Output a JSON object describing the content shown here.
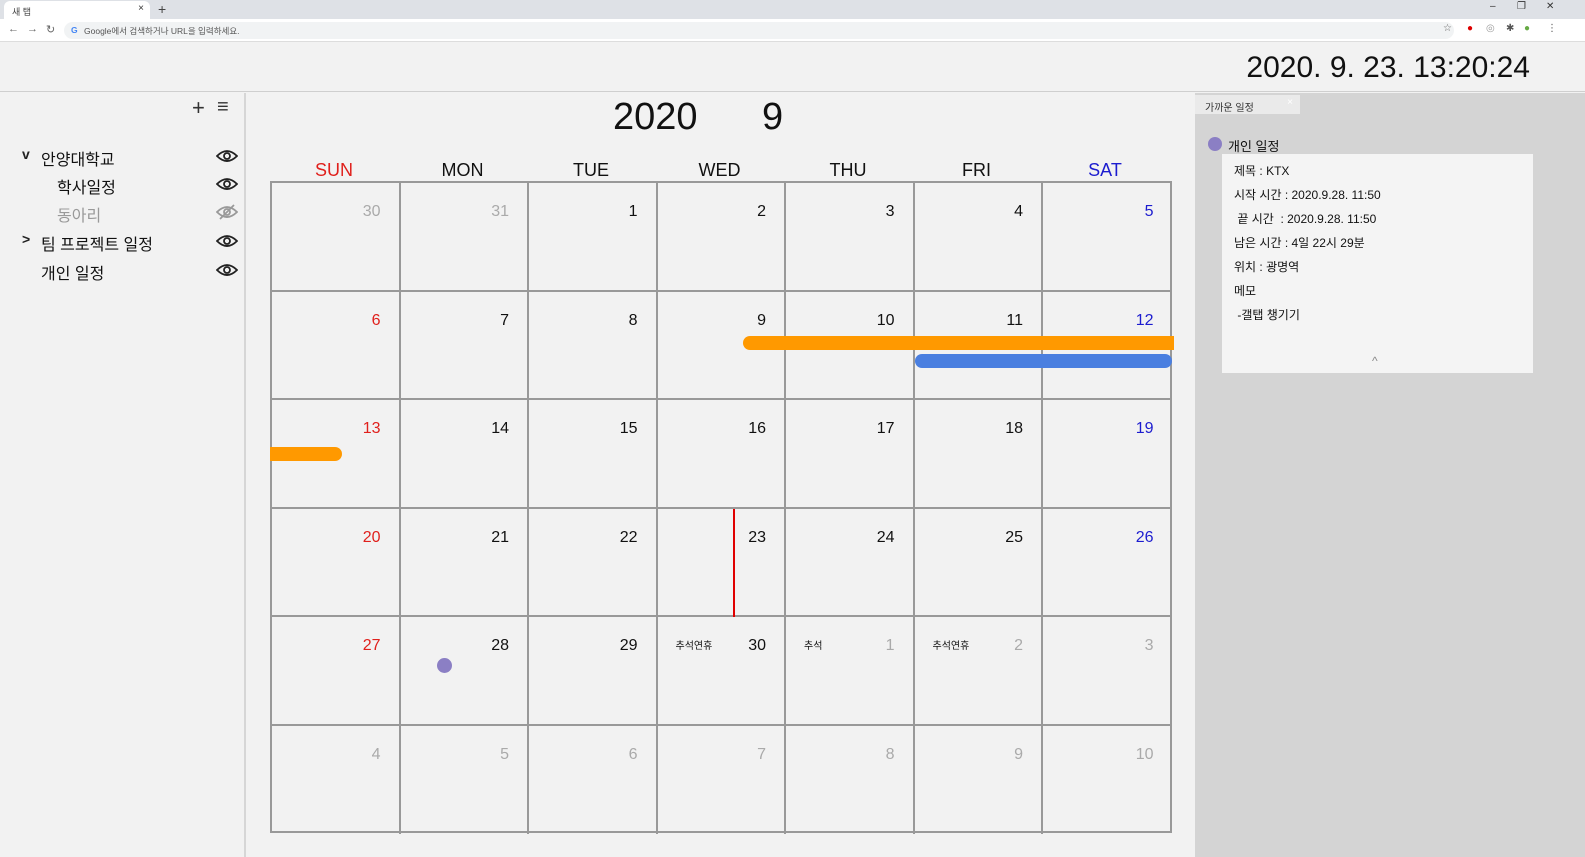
{
  "browser": {
    "tab_title": "새 탭",
    "tab_close": "×",
    "new_tab": "+",
    "omnibox_placeholder": "Google에서 검색하거나 URL을 입력하세요.",
    "win_min": "–",
    "win_restore": "❐",
    "win_close": "✕"
  },
  "header": {
    "clock": "2020. 9. 23. 13:20:24"
  },
  "sidebar": {
    "add_label": "+",
    "menu_label": "≡",
    "calendars": [
      {
        "label": "안양대학교",
        "chevron": "v",
        "level": 0,
        "visible": true
      },
      {
        "label": "학사일정",
        "chevron": "",
        "level": 1,
        "visible": true
      },
      {
        "label": "동아리",
        "chevron": "",
        "level": 1,
        "visible": false
      },
      {
        "label": "팀 프로젝트 일정",
        "chevron": ">",
        "level": 0,
        "visible": true
      },
      {
        "label": "개인 일정",
        "chevron": "",
        "level": 0,
        "visible": true
      }
    ]
  },
  "calendar": {
    "year": "2020",
    "month": "9",
    "weekdays": [
      "SUN",
      "MON",
      "TUE",
      "WED",
      "THU",
      "FRI",
      "SAT"
    ],
    "weeks": [
      [
        "30",
        "31",
        "1",
        "2",
        "3",
        "4",
        "5"
      ],
      [
        "6",
        "7",
        "8",
        "9",
        "10",
        "11",
        "12"
      ],
      [
        "13",
        "14",
        "15",
        "16",
        "17",
        "18",
        "19"
      ],
      [
        "20",
        "21",
        "22",
        "23",
        "24",
        "25",
        "26"
      ],
      [
        "27",
        "28",
        "29",
        "30",
        "1",
        "2",
        "3"
      ],
      [
        "4",
        "5",
        "6",
        "7",
        "8",
        "9",
        "10"
      ]
    ],
    "current_month_mask": [
      [
        false,
        false,
        true,
        true,
        true,
        true,
        true
      ],
      [
        true,
        true,
        true,
        true,
        true,
        true,
        true
      ],
      [
        true,
        true,
        true,
        true,
        true,
        true,
        true
      ],
      [
        true,
        true,
        true,
        true,
        true,
        true,
        true
      ],
      [
        true,
        true,
        true,
        true,
        false,
        false,
        false
      ],
      [
        false,
        false,
        false,
        false,
        false,
        false,
        false
      ]
    ],
    "holiday_labels": [
      {
        "week": 4,
        "day": 3,
        "text": "추석연휴"
      },
      {
        "week": 4,
        "day": 4,
        "text": "추석"
      },
      {
        "week": 4,
        "day": 5,
        "text": "추석연휴"
      }
    ],
    "colors": {
      "sunday": "#e0201c",
      "saturday": "#1c1ccf",
      "other_month": "#aaaaaa",
      "orange_event": "#ff9900",
      "blue_event": "#4a7fe0",
      "personal_event": "#8b7fc4",
      "today_line": "#e00000"
    }
  },
  "right_panel": {
    "tab_label": "가까운 일정",
    "tab_close": "×",
    "calendar_name": "개인 일정",
    "details": [
      "제목 : KTX",
      "시작 시간 : 2020.9.28. 11:50",
      " 끝 시간  : 2020.9.28. 11:50",
      "남은 시간 : 4일 22시 29분",
      "위치 : 광명역",
      "메모",
      " -갤탭 챙기기"
    ],
    "collapse_label": "^"
  }
}
